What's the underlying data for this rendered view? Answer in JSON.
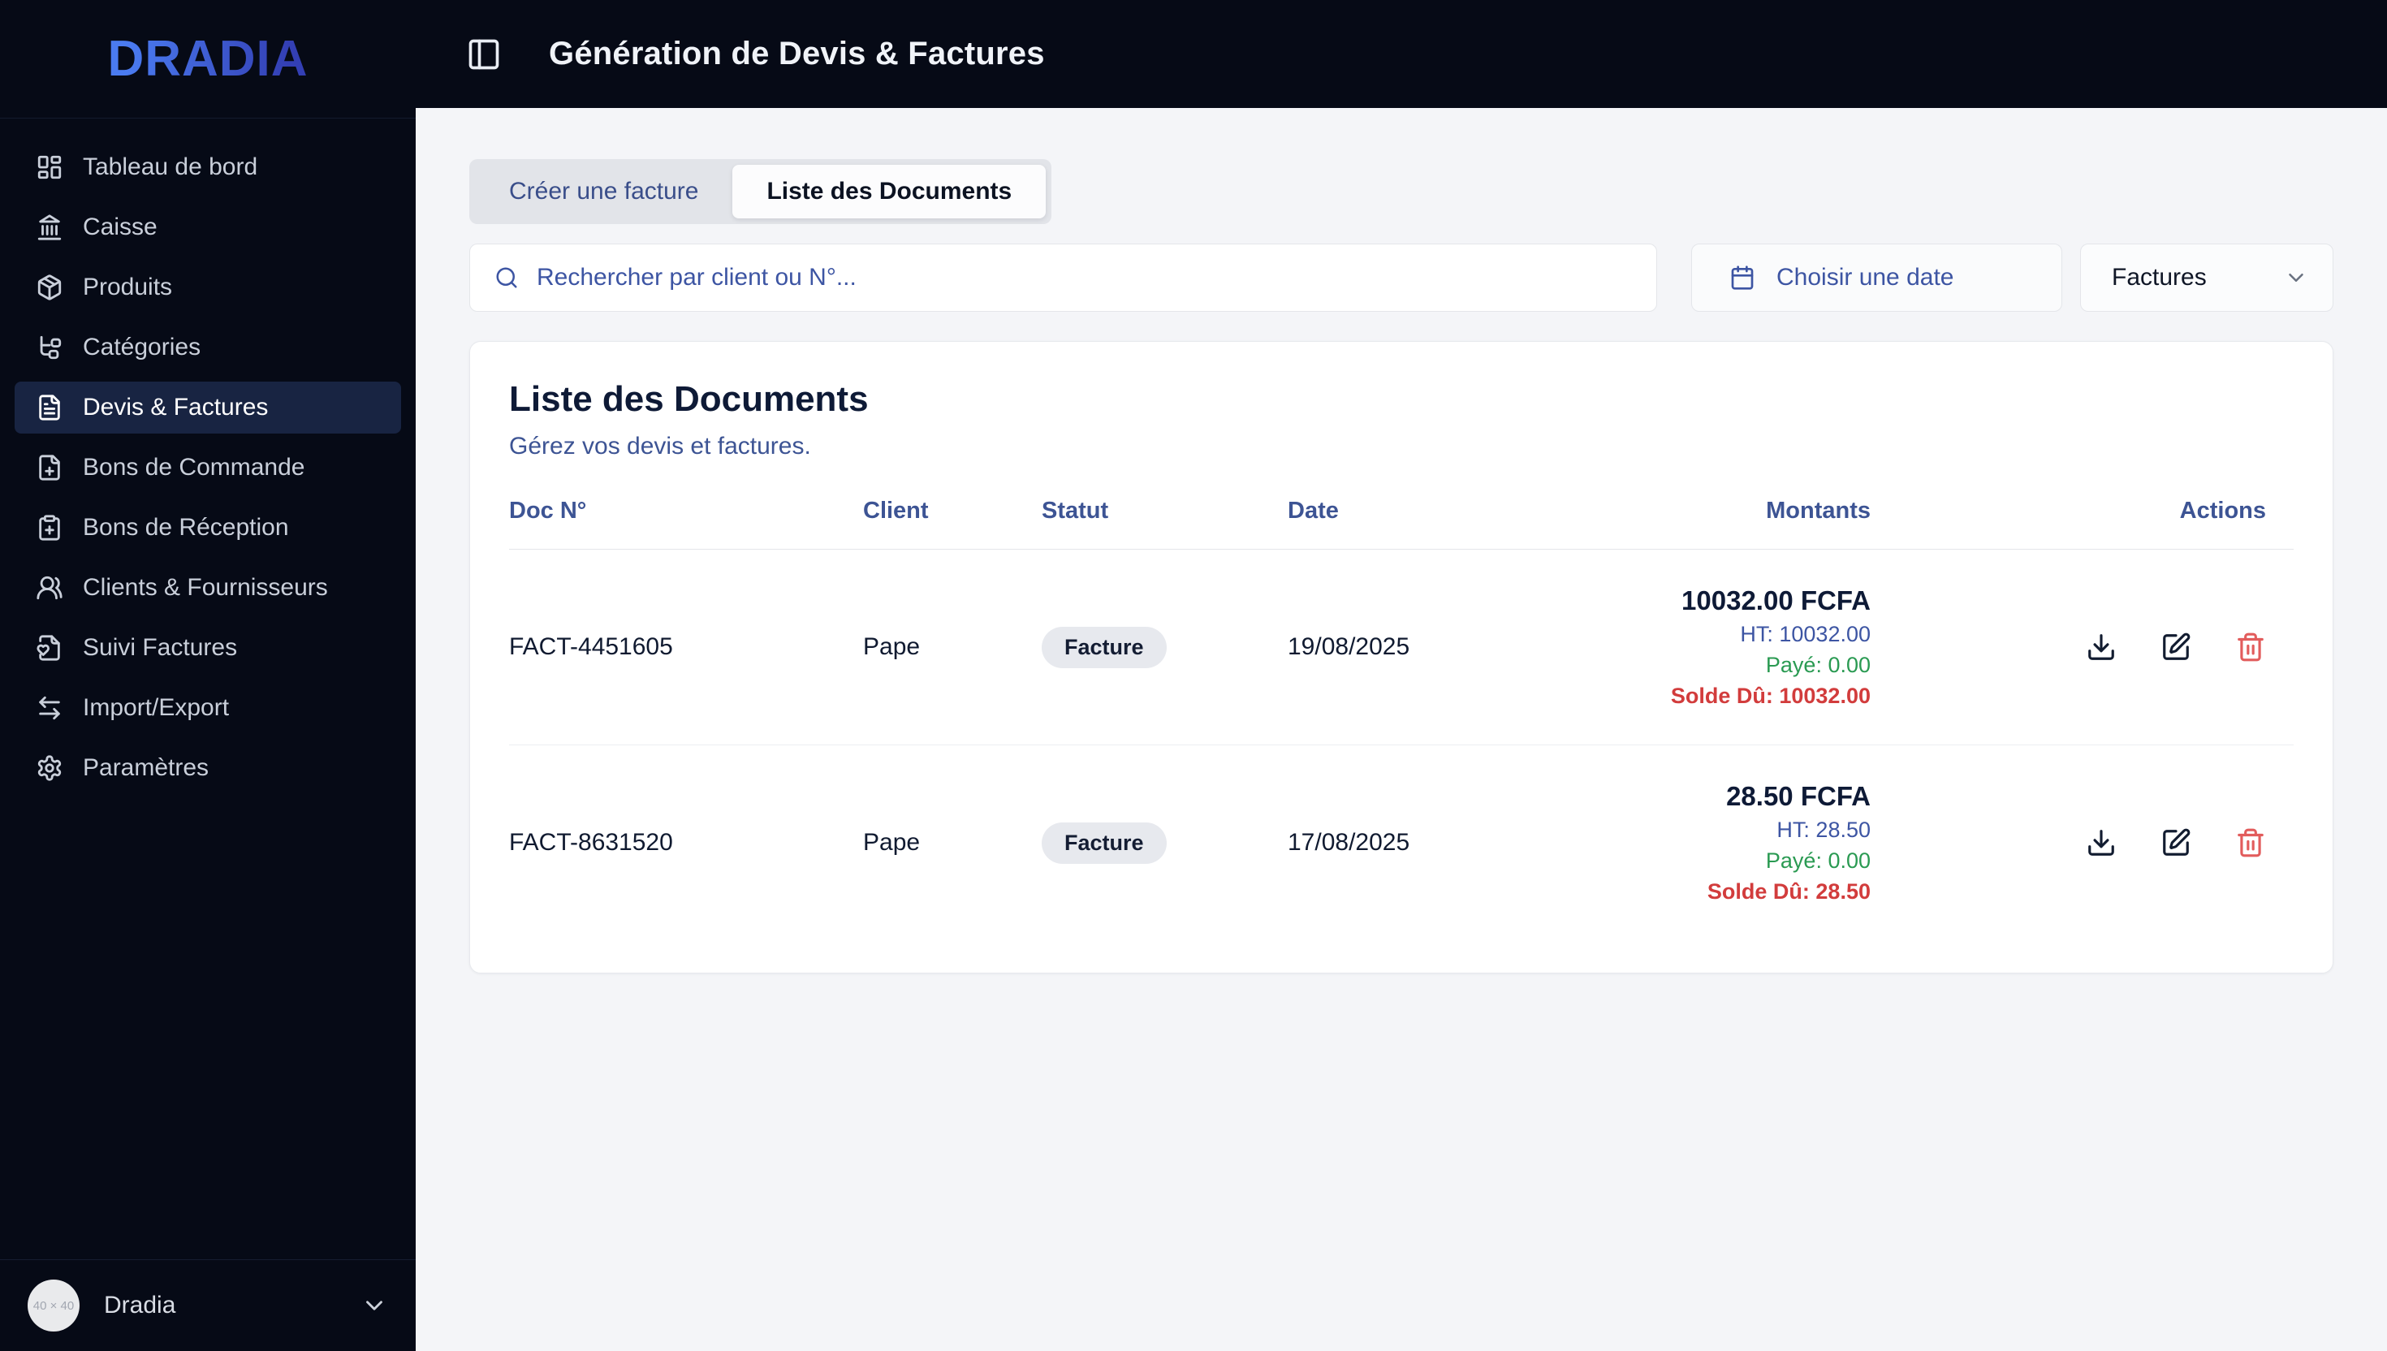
{
  "app": {
    "logo": "DRADIA",
    "header_title": "Génération de Devis & Factures"
  },
  "colors": {
    "sidebar_bg": "#060a16",
    "content_bg": "#f4f5f8",
    "logo_gradient": [
      "#4a7bf0",
      "#333fb4"
    ],
    "accent_indigo": "#3d55a3",
    "paid_green": "#2a9a52",
    "due_red": "#d23c3c",
    "danger_icon": "#e25c5c",
    "active_item_bg": "#182442"
  },
  "sidebar": {
    "items": [
      {
        "label": "Tableau de bord",
        "icon": "dashboard-icon",
        "active": false
      },
      {
        "label": "Caisse",
        "icon": "bank-icon",
        "active": false
      },
      {
        "label": "Produits",
        "icon": "package-icon",
        "active": false
      },
      {
        "label": "Catégories",
        "icon": "category-tree-icon",
        "active": false
      },
      {
        "label": "Devis & Factures",
        "icon": "file-text-icon",
        "active": true
      },
      {
        "label": "Bons de Commande",
        "icon": "file-plus-icon",
        "active": false
      },
      {
        "label": "Bons de Réception",
        "icon": "clipboard-plus-icon",
        "active": false
      },
      {
        "label": "Clients & Fournisseurs",
        "icon": "users-icon",
        "active": false
      },
      {
        "label": "Suivi Factures",
        "icon": "file-heart-icon",
        "active": false
      },
      {
        "label": "Import/Export",
        "icon": "arrows-left-right-icon",
        "active": false
      },
      {
        "label": "Paramètres",
        "icon": "gear-icon",
        "active": false
      }
    ],
    "user": {
      "name": "Dradia",
      "avatar_text": "40 × 40",
      "chevron": "chevron-down-icon"
    }
  },
  "tabs": [
    {
      "label": "Créer une facture",
      "active": false
    },
    {
      "label": "Liste des Documents",
      "active": true
    }
  ],
  "filters": {
    "search_placeholder": "Rechercher par client ou N°...",
    "date_button_label": "Choisir une date",
    "type_select_value": "Factures"
  },
  "documents": {
    "title": "Liste des Documents",
    "subtitle": "Gérez vos devis et factures.",
    "columns": [
      "Doc N°",
      "Client",
      "Statut",
      "Date",
      "Montants",
      "Actions"
    ],
    "rows": [
      {
        "doc_no": "FACT-4451605",
        "client": "Pape",
        "statut": "Facture",
        "date": "19/08/2025",
        "total": "10032.00 FCFA",
        "ht": "HT: 10032.00",
        "paye": "Payé: 0.00",
        "solde": "Solde Dû: 10032.00",
        "actions": [
          "download-icon",
          "edit-icon",
          "trash-icon"
        ]
      },
      {
        "doc_no": "FACT-8631520",
        "client": "Pape",
        "statut": "Facture",
        "date": "17/08/2025",
        "total": "28.50 FCFA",
        "ht": "HT: 28.50",
        "paye": "Payé: 0.00",
        "solde": "Solde Dû: 28.50",
        "actions": [
          "download-icon",
          "edit-icon",
          "trash-icon"
        ]
      }
    ]
  }
}
